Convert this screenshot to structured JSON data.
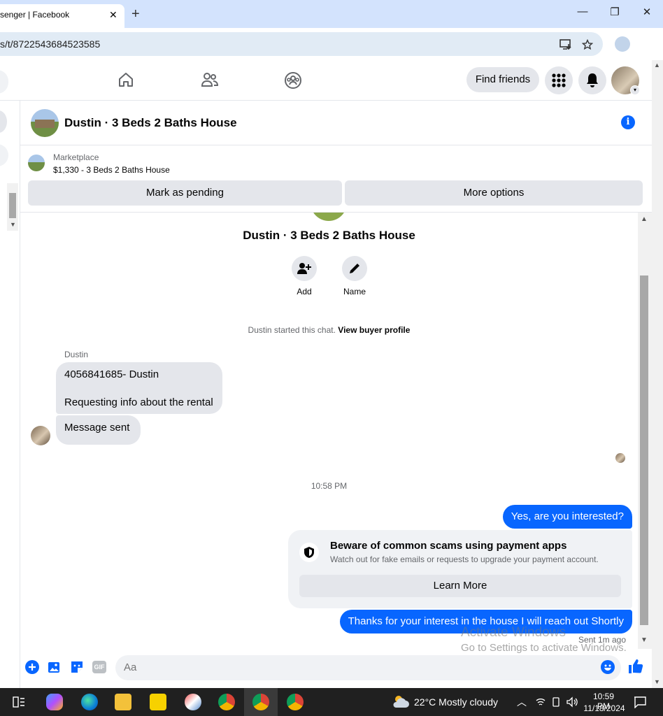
{
  "browser": {
    "tab_title": "senger | Facebook",
    "tab_close": "✕",
    "new_tab": "+",
    "url": "s/t/8722543684523585",
    "win_minimize": "—",
    "win_restore": "❐",
    "win_close": "✕",
    "menu": "⋮"
  },
  "nav": {
    "find_friends": "Find friends"
  },
  "chat": {
    "title": "Dustin · 3 Beds 2 Baths House",
    "info_glyph": "i"
  },
  "marketplace": {
    "label": "Marketplace",
    "listing": "$1,330 - 3 Beds 2 Baths House",
    "mark_pending": "Mark as pending",
    "more_options": "More options"
  },
  "intro": {
    "title": "Dustin · 3 Beds 2 Baths House",
    "add_label": "Add",
    "name_label": "Name",
    "started_text": "Dustin started this chat. ",
    "view_profile": "View buyer profile"
  },
  "messages": {
    "sender_name": "Dustin",
    "incoming_1_line1": "4056841685- Dustin",
    "incoming_1_line2": "Requesting info about the rental",
    "incoming_2": "Message sent",
    "timestamp": "10:58 PM",
    "outgoing_1": "Yes, are you interested?",
    "outgoing_2": "Thanks for your interest in the house I will reach out Shortly",
    "sent_status": "Sent 1m ago"
  },
  "scam_notice": {
    "title": "Beware of common scams using payment apps",
    "subtitle": "Watch out for fake emails or requests to upgrade your payment account.",
    "button": "Learn More"
  },
  "composer": {
    "placeholder": "Aa",
    "gif_label": "GIF"
  },
  "watermark": {
    "line1": "Activate Windows",
    "line2": "Go to Settings to activate Windows."
  },
  "taskbar": {
    "weather": "22°C  Mostly cloudy",
    "time": "10:59 PM",
    "date": "11/18/2024"
  },
  "colors": {
    "messenger_blue": "#0866ff",
    "bubble_gray": "#e4e6eb",
    "tab_strip": "#d3e3fd"
  }
}
